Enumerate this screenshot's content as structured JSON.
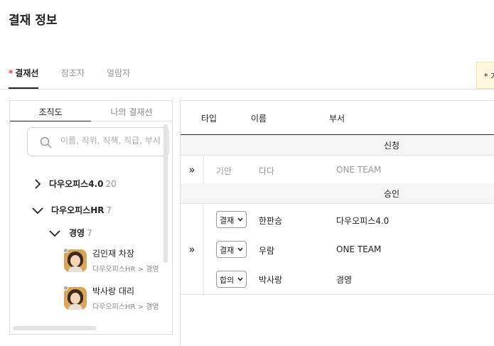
{
  "page": {
    "title": "결재 정보"
  },
  "tabs": [
    {
      "label": "결재선",
      "required_mark": "*"
    },
    {
      "label": "참조자"
    },
    {
      "label": "열람자"
    }
  ],
  "notice": {
    "text": "* 가"
  },
  "left_panel": {
    "tabs": [
      "조직도",
      "나의 결재선"
    ],
    "search_placeholder": "이름, 직위, 직책, 직급, 부서",
    "tree": [
      {
        "name": "다우오피스4.0",
        "count": "20",
        "expanded": false
      },
      {
        "name": "다우오피스HR",
        "count": "7",
        "expanded": true
      },
      {
        "name": "경영",
        "count": "7",
        "expanded": true
      }
    ],
    "people": [
      {
        "name": "김인재 차장",
        "path": "다우오피스HR > 경영"
      },
      {
        "name": "박사랑 대리",
        "path": "다우오피스HR > 경영"
      }
    ]
  },
  "approval_table": {
    "headers": [
      "타입",
      "이름",
      "부서"
    ],
    "arrow_glyph": "»",
    "groups": [
      {
        "title": "신청",
        "rows": [
          {
            "type": "기안",
            "name": "다다",
            "dept": "ONE TEAM"
          }
        ]
      },
      {
        "title": "승인",
        "rows": [
          {
            "type": "결재",
            "name": "한판승",
            "dept": "다우오피스4.0"
          },
          {
            "type": "결재",
            "name": "우람",
            "dept": "ONE TEAM"
          },
          {
            "type": "합의",
            "name": "박사랑",
            "dept": "경영"
          }
        ]
      }
    ]
  },
  "colors": {
    "required": "#e53935",
    "notice_bg": "#fff8dc",
    "count_gray": "#999999"
  }
}
